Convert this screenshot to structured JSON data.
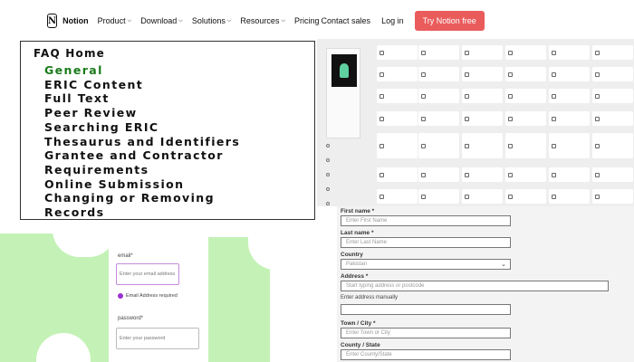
{
  "notion_nav": {
    "brand": "Notion",
    "links": [
      "Product",
      "Download",
      "Solutions",
      "Resources"
    ],
    "pricing": "Pricing",
    "contact_sales": "Contact sales",
    "login": "Log in",
    "cta": "Try Notion free",
    "cta_color": "#ea5c5c"
  },
  "faq": {
    "title": "FAQ Home",
    "items": [
      "General",
      "ERIC Content",
      "Full Text",
      "Peer Review",
      "Searching ERIC",
      "Thesaurus and Identifiers",
      "Grantee and Contractor",
      "Requirements",
      "Online Submission",
      "Changing or Removing",
      "Records"
    ],
    "active_index": 0,
    "active_color": "#1a7a1a"
  },
  "address_form": {
    "first_name_label": "First name *",
    "first_name_placeholder": "Enter First Name",
    "last_name_label": "Last name *",
    "last_name_placeholder": "Enter Last Name",
    "country_label": "Country",
    "country_value": "Pakistan",
    "address_label": "Address *",
    "address_placeholder": "Start typing address or postcode",
    "manual_link": "Enter address manually",
    "town_label": "Town / City *",
    "town_placeholder": "Enter Town or City",
    "county_label": "County / State",
    "county_placeholder": "Enter County/State"
  },
  "login": {
    "email_label": "email*",
    "email_placeholder": "Enter your email address",
    "email_error": "Email Address required",
    "password_label": "password*",
    "password_placeholder": "Enter your password",
    "error_color": "#9b30d0"
  }
}
